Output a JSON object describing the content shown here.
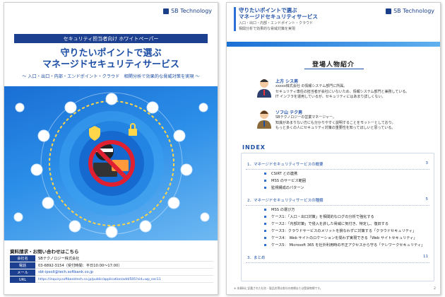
{
  "brand": "SB Technology",
  "page1": {
    "banner": "セキュリティ担当者向け ホワイトペーパー",
    "title_line1": "守りたいポイントで選ぶ",
    "title_line2": "マネージドセキュリティサービス",
    "subtitle": "～ 入口・出口・内部・エンドポイント・クラウド　相関分析で効果的な脅威対策を実現 ～",
    "contact_heading": "資料請求・お問い合わせはこちら",
    "contact": [
      {
        "key": "会社名",
        "value": "SBテクノロジー株式会社"
      },
      {
        "key": "電話",
        "value": "03-6892-3154（受付時間：平日10:00〜17:00）"
      },
      {
        "key": "メール",
        "value": "sbt-ipsoll@tech.softbank.co.jp"
      },
      {
        "key": "URL",
        "value": "https://inquiry.softbanktech.co.jp/public/application/add/505?sid=wp_sec11"
      }
    ]
  },
  "page2": {
    "header_title_line1": "守りたいポイントで選ぶ",
    "header_title_line2": "マネージドセキュリティサービス",
    "header_sub": "相関分析で効果的な脅威対策を実現",
    "header_sub_top": "入口・出口・内部・エンドポイント・クラウド",
    "characters_title": "登場人物紹介",
    "persons": [
      {
        "name": "上方 シス男",
        "desc": "xxxxx株式会社 の情報システム部門に所属。\nセキュリティ専任の担当者が会社にいないため、情報システム部門と兼務している。\nIT インフラを運用しているが、セキュリティにはあまり詳しくない。"
      },
      {
        "name": "ソフ山 テク男",
        "desc": "SBテクノロジーの営業マネージャー。\n知識があまりない方にも分かりやすく説明することをモットーとしており。\nもっと多くの人にセキュリティ対策の重要性を知ってほしいと思っている。"
      }
    ],
    "index_title": "INDEX",
    "chapters": [
      {
        "title": "1．マネージドセキュリティサービスの概要",
        "page": "3",
        "items": [
          "CSIRT との連携",
          "MSS のサービス範囲",
          "監視構成のパターン"
        ]
      },
      {
        "title": "2．マネージドセキュリティサービスの種類",
        "page": "5",
        "items": [
          "MSS の選び方",
          "ケース1：「入口・出口対策」を相関的なログの分析で強化する",
          "ケース2：「内部対策」で侵入を許した脅威に気付き、特定し、復旧する",
          "ケース3：クラウドサービスのメリットを損なわずに対策する「クラウドセキュリティ」",
          "ケース4： Web サイトのロケーションを問わず実現できる「Web サイトセキュリティ」",
          "ケース5： Microsoft 365 を社外利用時の不正アクセスから守る「テレワークセキュリティ」"
        ]
      },
      {
        "title": "3．まとめ",
        "page": "11",
        "items": []
      }
    ],
    "footnote": "※ 本資料に記載された社名・製品名等は各社の商標または登録商標です。",
    "page_number": "2"
  }
}
